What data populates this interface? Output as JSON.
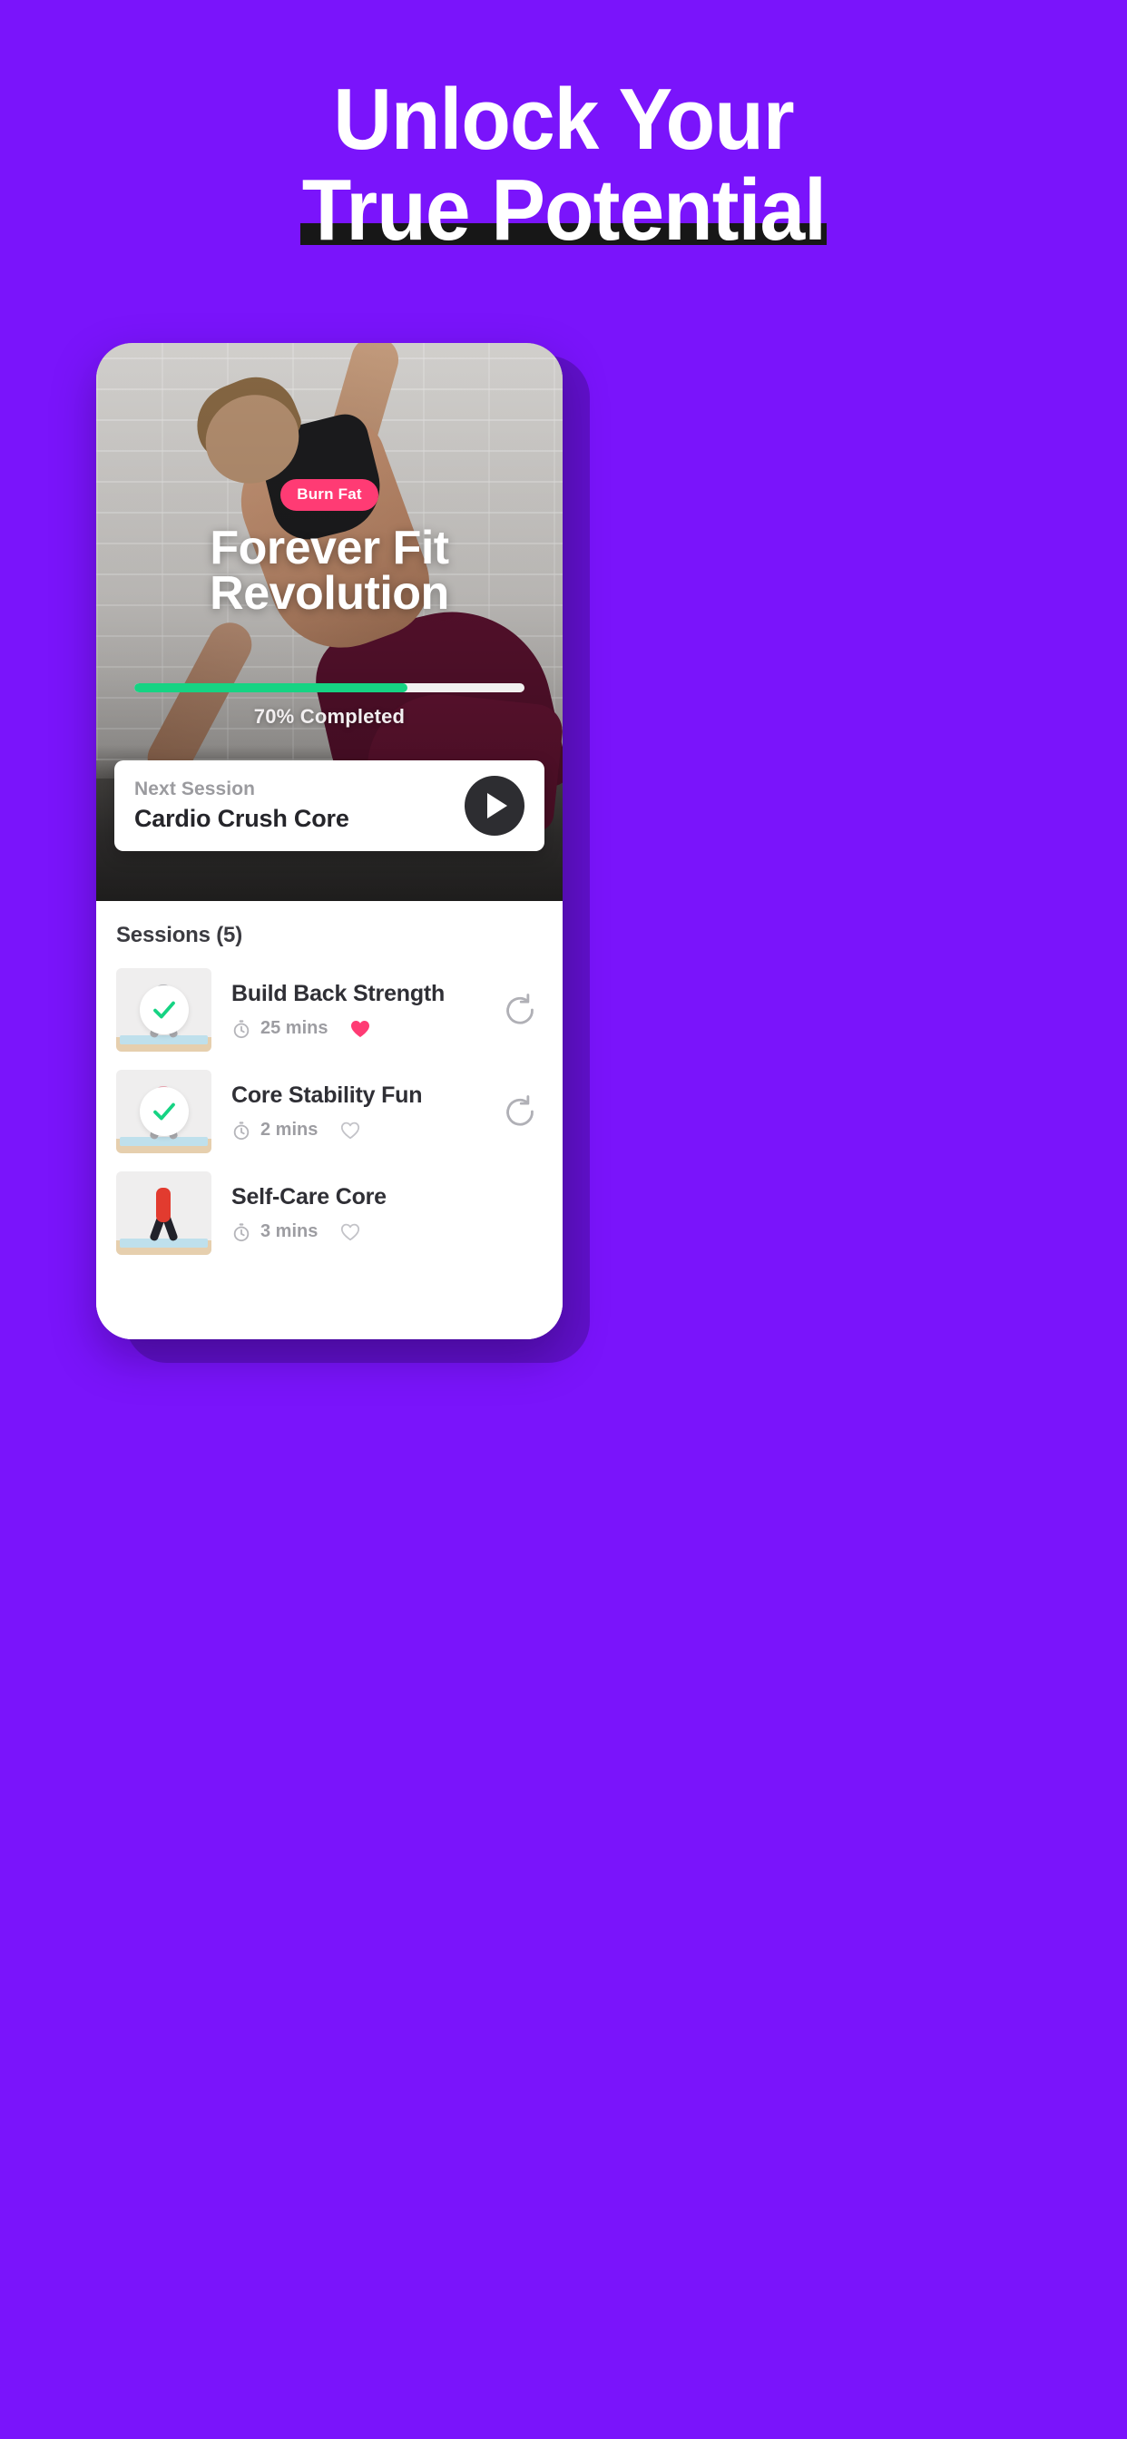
{
  "theme": {
    "background": "#7a14fb",
    "accent_pink": "#ff3b74",
    "progress_green": "#16d383",
    "underline_black": "#171717",
    "card_white": "#ffffff"
  },
  "headline": {
    "line1": "Unlock Your",
    "line2": "True Potential"
  },
  "hero": {
    "badge": "Burn Fat",
    "title_line1": "Forever Fit",
    "title_line2": "Revolution",
    "progress_percent": 70,
    "progress_label": "70% Completed"
  },
  "next_session": {
    "label": "Next Session",
    "title": "Cardio Crush Core",
    "play_icon": "play-icon"
  },
  "sessions_panel": {
    "heading": "Sessions (5)",
    "count": 5,
    "items": [
      {
        "name": "Build Back Strength",
        "duration": "25 mins",
        "clock_icon": "stopwatch-icon",
        "favorite_icon": "heart-filled-icon",
        "favorited": true,
        "restart_icon": "restart-icon",
        "completed": true,
        "thumb_style": "triangle-pose"
      },
      {
        "name": "Core Stability Fun",
        "duration": "2 mins",
        "clock_icon": "stopwatch-icon",
        "favorite_icon": "heart-outline-icon",
        "favorited": false,
        "restart_icon": "restart-icon",
        "completed": true,
        "thumb_style": "forward-fold-pose"
      },
      {
        "name": "Self-Care Core",
        "duration": "3 mins",
        "clock_icon": "stopwatch-icon",
        "favorite_icon": "heart-outline-icon",
        "favorited": false,
        "restart_icon": "",
        "completed": false,
        "thumb_style": "camel-pose"
      }
    ]
  }
}
